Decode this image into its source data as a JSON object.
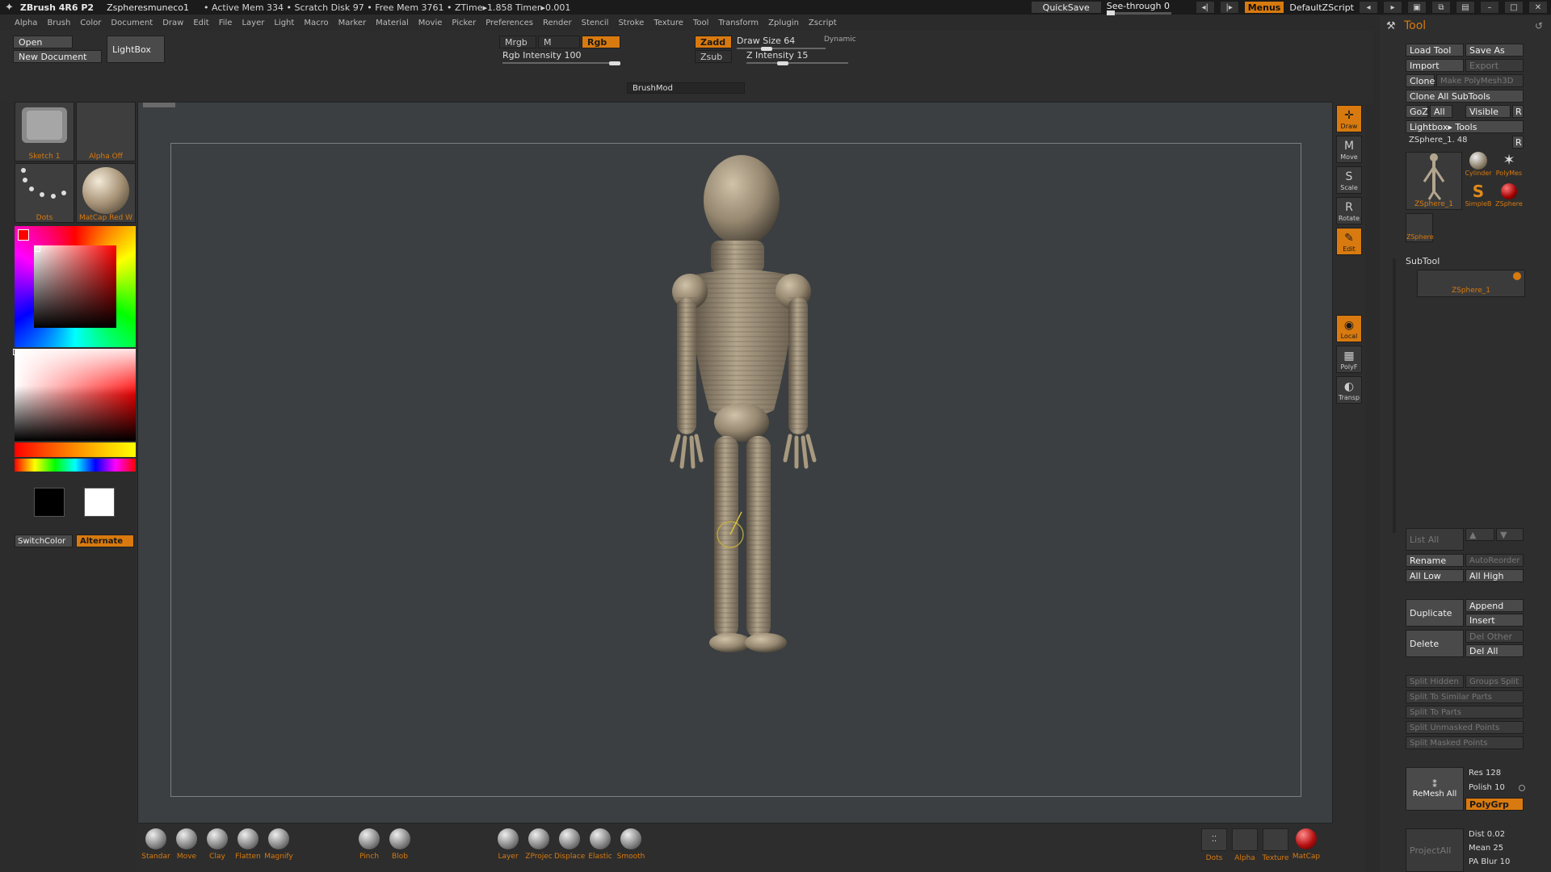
{
  "titlebar": {
    "app": "ZBrush 4R6 P2",
    "file": "Zspheresmuneco1",
    "stats": "• Active Mem 334 • Scratch Disk 97 • Free Mem 3761 • ZTime▸1.858 Timer▸0.001",
    "quicksave": "QuickSave",
    "see_through": "See-through  0",
    "menus": "Menus",
    "script": "DefaultZScript"
  },
  "menubar": [
    "Alpha",
    "Brush",
    "Color",
    "Document",
    "Draw",
    "Edit",
    "File",
    "Layer",
    "Light",
    "Macro",
    "Marker",
    "Material",
    "Movie",
    "Picker",
    "Preferences",
    "Render",
    "Stencil",
    "Stroke",
    "Texture",
    "Tool",
    "Transform",
    "Zplugin",
    "Zscript"
  ],
  "topshelf": {
    "open": "Open",
    "new_document": "New Document",
    "lightbox": "LightBox",
    "mrgb": "Mrgb",
    "m": "M",
    "rgb": "Rgb",
    "rgb_intensity": "Rgb Intensity 100",
    "zadd": "Zadd",
    "zsub": "Zsub",
    "draw_size": "Draw Size 64",
    "dynamic": "Dynamic",
    "z_intensity": "Z Intensity 15",
    "brushmod": "BrushMod"
  },
  "leftpanel": {
    "thumb1": "Sketch 1",
    "thumb2": "Alpha Off",
    "thumb3": "Dots",
    "thumb4": "MatCap Red W",
    "switchcolor": "SwitchColor",
    "alternate": "Alternate",
    "colors": {
      "main": "#ff0000",
      "primary": "#000000",
      "secondary": "#ffffff"
    }
  },
  "bottom_brushes": [
    "Standar",
    "Move",
    "Clay",
    "Flatten",
    "Magnify",
    "Pinch",
    "Blob",
    "Layer",
    "ZProjec",
    "Displace",
    "Elastic",
    "Smooth"
  ],
  "bottom_right": [
    "Dots",
    "Alpha",
    "Texture",
    "MatCap"
  ],
  "rightstrip": {
    "draw": "Draw",
    "move": "Move",
    "scale": "Scale",
    "rotate": "Rotate",
    "edit": "Edit",
    "local": "Local",
    "polyf": "PolyF",
    "transp": "Transp"
  },
  "tool": {
    "title": "Tool",
    "load_tool": "Load Tool",
    "save_as": "Save As",
    "import": "Import",
    "export": "Export",
    "clone": "Clone",
    "make_polymesh": "Make PolyMesh3D",
    "clone_all": "Clone  All SubTools",
    "goz": "GoZ",
    "all": "All",
    "visible": "Visible",
    "r": "R",
    "lightbox_tools": "Lightbox▸ Tools",
    "zsphere_value": "ZSphere_1. 48",
    "thumb_main": "ZSphere_1",
    "thumb_cyl": "Cylinder",
    "thumb_poly": "PolyMes",
    "thumb_simple": "SimpleB",
    "thumb_zsphere": "ZSphere",
    "thumb_small": "ZSphere",
    "subtool": "SubTool",
    "subtool_item": "ZSphere_1",
    "list_all": "List All",
    "rename": "Rename",
    "autoreorder": "AutoReorder",
    "all_low": "All Low",
    "all_high": "All High",
    "duplicate": "Duplicate",
    "append": "Append",
    "insert": "Insert",
    "delete": "Delete",
    "del_other": "Del Other",
    "del_all": "Del All",
    "split_hidden": "Split Hidden",
    "groups_split": "Groups Split",
    "split_similar": "Split To Similar Parts",
    "split_parts": "Split To Parts",
    "split_unmasked": "Split Unmasked Points",
    "split_masked": "Split Masked Points",
    "remesh_all": "ReMesh  All",
    "res": "Res 128",
    "polish": "Polish 10",
    "polygrp": "PolyGrp",
    "project_all": "ProjectAll",
    "dist": "Dist 0.02",
    "mean": "Mean 25",
    "pa_blur": "PA Blur 10"
  }
}
